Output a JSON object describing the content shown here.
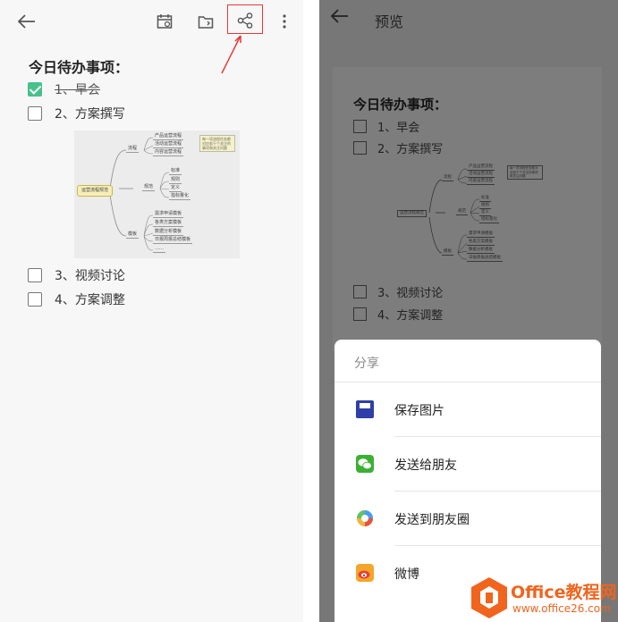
{
  "left": {
    "note_title": "今日待办事项：",
    "todos": [
      {
        "label": "1、早会",
        "checked": true
      },
      {
        "label": "2、方案撰写",
        "checked": false
      },
      {
        "label": "3、视频讨论",
        "checked": false
      },
      {
        "label": "4、方案调整",
        "checked": false
      }
    ],
    "mindmap": {
      "root": "运营流程规范",
      "branches": [
        {
          "label": "流程",
          "children": [
            "产品运营流程",
            "活动运营流程",
            "内容运营流程"
          ]
        },
        {
          "label": "规范",
          "children": [
            "标准",
            "规则",
            "定义",
            "指标量化"
          ]
        },
        {
          "label": "模板",
          "children": [
            "需求申请模板",
            "各类方案模板",
            "数据分析模板",
            "日报周报总结模板",
            "……"
          ]
        }
      ],
      "note": "每一项流程任务都对应若干个关注的事项和关注问题"
    },
    "icons": [
      "back-arrow-icon",
      "calendar-icon",
      "folder-icon",
      "share-icon",
      "more-icon"
    ]
  },
  "right": {
    "header_title": "预览",
    "preview_title": "今日待办事项：",
    "preview_todos": [
      "1、早会",
      "2、方案撰写",
      "3、视频讨论",
      "4、方案调整"
    ],
    "sheet": {
      "title": "分享",
      "items": [
        {
          "label": "保存图片",
          "icon": "save-image-icon"
        },
        {
          "label": "发送给朋友",
          "icon": "wechat-icon"
        },
        {
          "label": "发送到朋友圈",
          "icon": "moments-icon"
        },
        {
          "label": "微博",
          "icon": "weibo-icon"
        }
      ]
    }
  },
  "watermark": {
    "brand": "Office教程网",
    "url": "www.office26.com"
  },
  "colors": {
    "accent_green": "#46c18b",
    "highlight_red": "#e53935",
    "overlay": "#777777",
    "watermark_orange": "#f0641e"
  }
}
